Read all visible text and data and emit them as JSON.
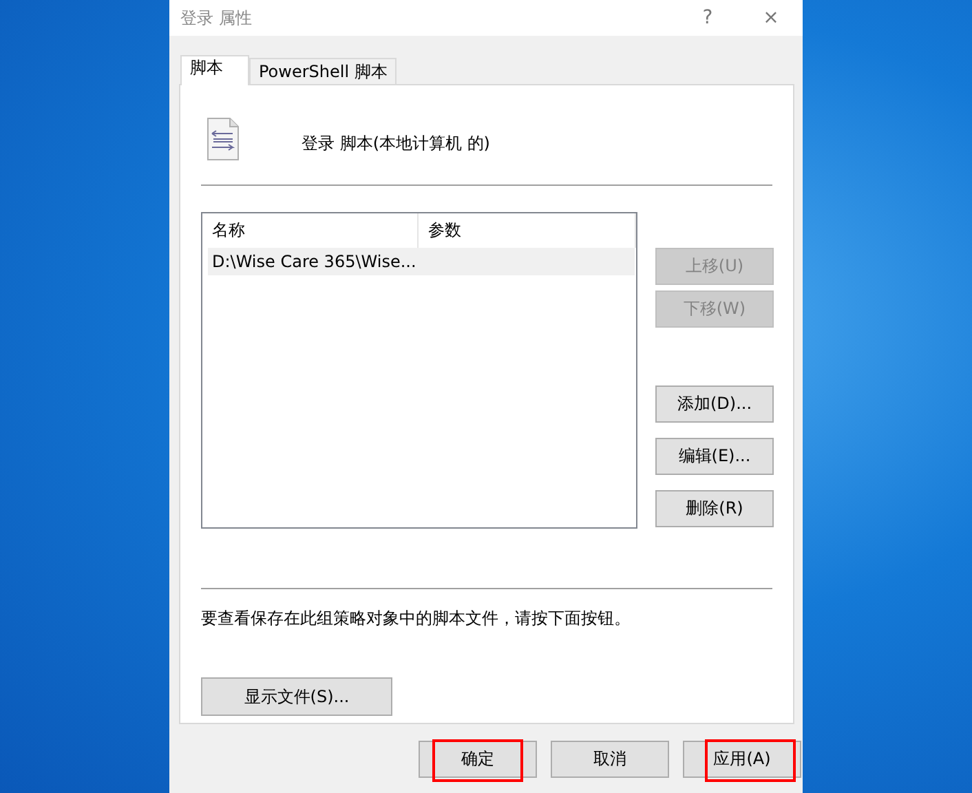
{
  "window": {
    "title": "登录 属性",
    "help": "?",
    "close": "×"
  },
  "tabs": [
    {
      "label": "脚本",
      "selected": true
    },
    {
      "label": "PowerShell 脚本",
      "selected": false
    }
  ],
  "heading": "登录 脚本(本地计算机 的)",
  "script_list": {
    "columns": [
      "名称",
      "参数"
    ],
    "rows": [
      {
        "cells": [
          "D:\\Wise Care 365\\Wise...",
          ""
        ],
        "selected": true
      }
    ]
  },
  "move_buttons": [
    {
      "label": "上移(U)",
      "disabled": true
    },
    {
      "label": "下移(W)",
      "disabled": true
    }
  ],
  "edit_buttons": [
    {
      "label": "添加(D)...",
      "disabled": false
    },
    {
      "label": "编辑(E)...",
      "disabled": false
    },
    {
      "label": "删除(R)",
      "disabled": false
    }
  ],
  "info_text": "要查看保存在此组策略对象中的脚本文件，请按下面按钮。",
  "show_files_button": "显示文件(S)...",
  "dialog_buttons": [
    {
      "label": "确定",
      "highlighted": true
    },
    {
      "label": "取消",
      "highlighted": false
    },
    {
      "label": "应用(A)",
      "highlighted": true
    }
  ]
}
